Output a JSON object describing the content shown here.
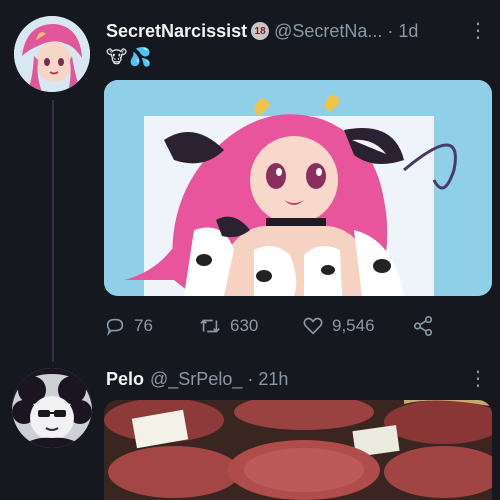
{
  "tweet1": {
    "display_name": "SecretNarcissist",
    "badge": "18",
    "handle_time": "@SecretNa... · 1d",
    "more_icon": "vertical-ellipsis",
    "emoji": [
      "🐮",
      "💦"
    ],
    "reply_count": "76",
    "retweet_count": "630",
    "like_count": "9,546"
  },
  "tweet2": {
    "display_name": "Pelo",
    "handle_time": "@_SrPelo_ · 21h",
    "more_icon": "vertical-ellipsis"
  },
  "colors": {
    "background": "#15181e",
    "name": "#f2f2f2",
    "muted": "#8b98a5",
    "thread_line": "#3a2e4a"
  }
}
